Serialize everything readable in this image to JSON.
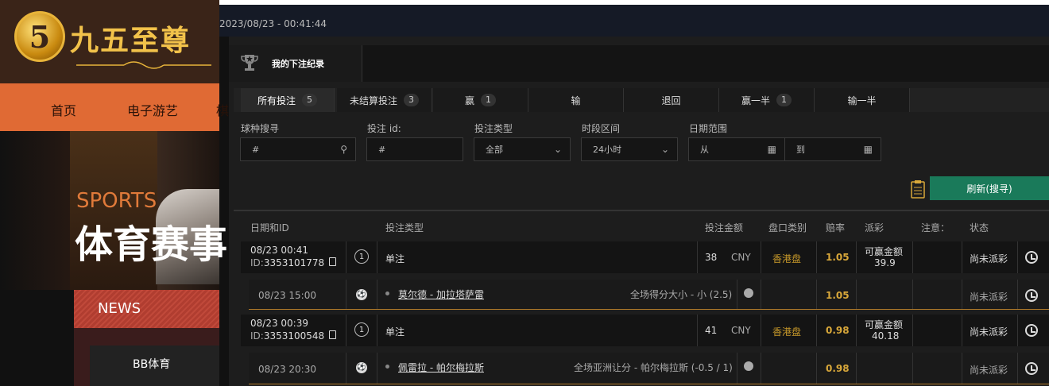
{
  "site": {
    "logo_text": "九五至尊",
    "nav": [
      "首页",
      "电子游艺",
      "棋"
    ],
    "hero_label": "SPORTS",
    "hero_title": "体育赛事",
    "news_label": "NEWS",
    "bb_label": "BB体育"
  },
  "topbar": {
    "timestamp": "2023/08/23 - 00:41:44"
  },
  "panel": {
    "title": "我的下注纪录",
    "tabs": [
      {
        "label": "所有投注",
        "count": "5",
        "active": true
      },
      {
        "label": "未结算投注",
        "count": "3"
      },
      {
        "label": "赢",
        "count": "1"
      },
      {
        "label": "输",
        "count": ""
      },
      {
        "label": "退回",
        "count": ""
      },
      {
        "label": "赢一半",
        "count": "1"
      },
      {
        "label": "输一半",
        "count": ""
      }
    ],
    "filters": {
      "sport_label": "球种搜寻",
      "sport_placeholder": "#",
      "betid_label": "投注 id:",
      "betid_placeholder": "#",
      "bettype_label": "投注类型",
      "bettype_value": "全部",
      "period_label": "时段区间",
      "period_value": "24小时",
      "date_label": "日期范围",
      "date_from": "从",
      "date_to": "到"
    },
    "refresh_label": "刷新(搜寻)"
  },
  "table": {
    "headers": [
      "日期和ID",
      "投注类型",
      "投注金额",
      "盘口类别",
      "赔率",
      "派彩",
      "注意：",
      "状态"
    ],
    "rows": [
      {
        "date": "08/23 00:41",
        "id_prefix": "ID:",
        "id": "3353101778",
        "bet_no": "1",
        "type": "单注",
        "amount": "38",
        "currency": "CNY",
        "market": "香港盘",
        "odds": "1.05",
        "payout_label": "可赢金额",
        "payout": "39.9",
        "status": "尚未派彩",
        "detail": {
          "date": "08/23 15:00",
          "match": "莫尔德 - 加拉塔萨雷",
          "selection": "全场得分大小 - 小 (2.5)",
          "odds": "1.05",
          "status": "尚未派彩"
        }
      },
      {
        "date": "08/23 00:39",
        "id_prefix": "ID:",
        "id": "3353100548",
        "bet_no": "1",
        "type": "单注",
        "amount": "41",
        "currency": "CNY",
        "market": "香港盘",
        "odds": "0.98",
        "payout_label": "可赢金额",
        "payout": "40.18",
        "status": "尚未派彩",
        "detail": {
          "date": "08/23 20:30",
          "match": "佩雷拉 - 帕尔梅拉斯",
          "selection": "全场亚洲让分 - 帕尔梅拉斯 (-0.5 / 1)",
          "odds": "0.98",
          "status": "尚未派彩"
        }
      }
    ]
  },
  "colors": {
    "accent_nav": "#e06a34",
    "refresh_button": "#1a7a5a",
    "gold": "#d9a83a"
  }
}
